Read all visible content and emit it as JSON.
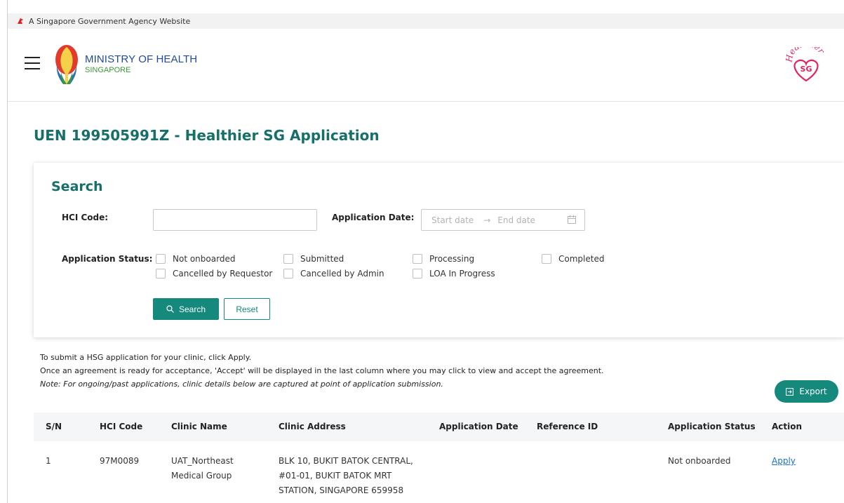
{
  "gov_bar": {
    "text": "A Singapore Government Agency Website"
  },
  "header": {
    "logo_line1": "MINISTRY OF HEALTH",
    "logo_line2": "SINGAPORE",
    "hsg_logo_text": "Healthier",
    "hsg_logo_badge": "SG"
  },
  "page": {
    "title": "UEN 199505991Z - Healthier SG Application"
  },
  "search": {
    "title": "Search",
    "hci_code_label": "HCI Code:",
    "hci_code_value": "",
    "application_date_label": "Application Date:",
    "start_date_placeholder": "Start date",
    "end_date_placeholder": "End date",
    "status_label": "Application Status:",
    "statuses": [
      "Not onboarded",
      "Submitted",
      "Processing",
      "Completed",
      "Cancelled by Requestor",
      "Cancelled by Admin",
      "LOA In Progress"
    ],
    "search_button": "Search",
    "reset_button": "Reset"
  },
  "info": {
    "line1": "To submit a HSG application for your clinic, click Apply.",
    "line2": "Once an agreement is ready for acceptance, 'Accept' will be displayed in the last column where you may click to view and accept the agreement.",
    "note": "Note: For ongoing/past applications, clinic details below are captured at point of application submission."
  },
  "export_button": "Export",
  "table": {
    "headers": [
      "S/N",
      "HCI Code",
      "Clinic Name",
      "Clinic Address",
      "Application Date",
      "Reference ID",
      "Application Status",
      "Action"
    ],
    "rows": [
      {
        "sn": "1",
        "hci_code": "97M0089",
        "clinic_name_l1": "UAT_Northeast",
        "clinic_name_l2": "Medical Group",
        "address_l1": "BLK 10, BUKIT BATOK CENTRAL,",
        "address_l2": "#01-01, BUKIT BATOK MRT",
        "address_l3": "STATION, SINGAPORE 659958",
        "application_date": "",
        "reference_id": "",
        "status": "Not onboarded",
        "action": "Apply"
      }
    ]
  },
  "colors": {
    "accent": "#14897c",
    "title": "#176f6a",
    "link": "#1a6dd8",
    "moh_blue": "#1e4b9b",
    "moh_green": "#3a9a3a",
    "hsg_red": "#e0245e"
  }
}
